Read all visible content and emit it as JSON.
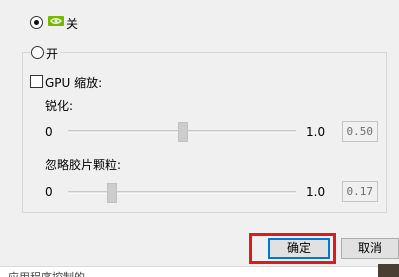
{
  "options": {
    "off_label": "关",
    "on_label": "开",
    "off_selected": true
  },
  "gpu_scaling": {
    "label": "GPU 缩放:",
    "checked": false
  },
  "sharpen": {
    "label": "锐化:",
    "min_label": "0",
    "max_label": "1.0",
    "value": "0.50",
    "level": 0.5
  },
  "grain": {
    "label": "忽略胶片颗粒:",
    "min_label": "0",
    "max_label": "1.0",
    "value": "0.17",
    "level": 0.17
  },
  "buttons": {
    "ok": "确定",
    "cancel": "取消"
  },
  "status": {
    "text": "应用程序控制的"
  },
  "icons": {
    "nv_logo": "nvidia-logo-icon",
    "logo_color": "#76b900"
  },
  "colors": {
    "highlight": "#e0191b",
    "default_button_border": "#0078d7"
  }
}
